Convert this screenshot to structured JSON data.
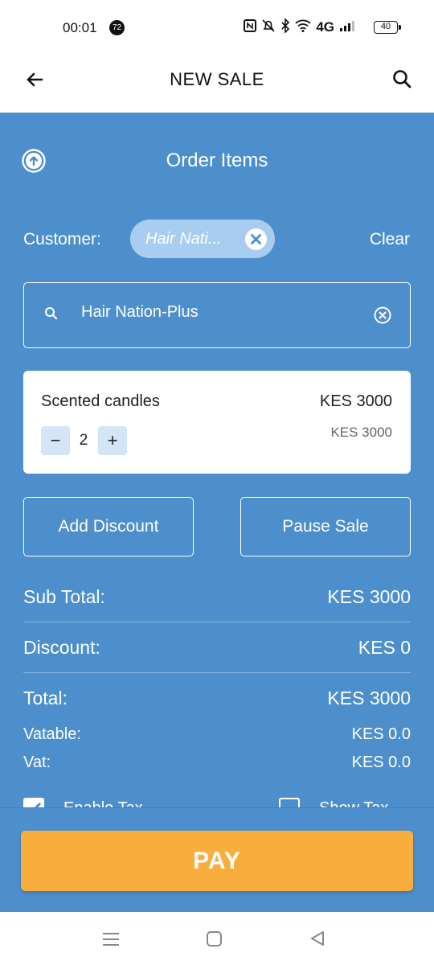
{
  "status_bar": {
    "time": "00:01",
    "notification_count": "72",
    "network": "4G",
    "battery": "40"
  },
  "app_bar": {
    "title": "NEW SALE",
    "back_icon": "arrow-left-icon",
    "search_icon": "search-icon"
  },
  "order": {
    "section_title": "Order Items",
    "customer_label": "Customer:",
    "customer_chip": "Hair Nati...",
    "clear_label": "Clear",
    "search_value": "Hair Nation-Plus"
  },
  "items": [
    {
      "name": "Scented candles",
      "price": "KES 3000",
      "unit_price": "KES 3000",
      "quantity": "2",
      "minus": "−",
      "plus": "+"
    }
  ],
  "actions": {
    "add_discount": "Add Discount",
    "pause_sale": "Pause Sale"
  },
  "totals": {
    "subtotal_label": "Sub Total:",
    "subtotal_value": "KES 3000",
    "discount_label": "Discount:",
    "discount_value": "KES 0",
    "total_label": "Total:",
    "total_value": "KES 3000",
    "vatable_label": "Vatable:",
    "vatable_value": "KES 0.0",
    "vat_label": "Vat:",
    "vat_value": "KES 0.0"
  },
  "tax_options": {
    "enable_tax_label": "Enable Tax",
    "enable_tax_checked": true,
    "show_tax_label": "Show Tax",
    "show_tax_checked": false
  },
  "pay": {
    "label": "PAY"
  },
  "colors": {
    "primary_blue": "#4d8fcd",
    "pay_orange": "#f8ad3d",
    "chip_blue": "#a9cdf0",
    "qty_button": "#d3e5f6"
  }
}
